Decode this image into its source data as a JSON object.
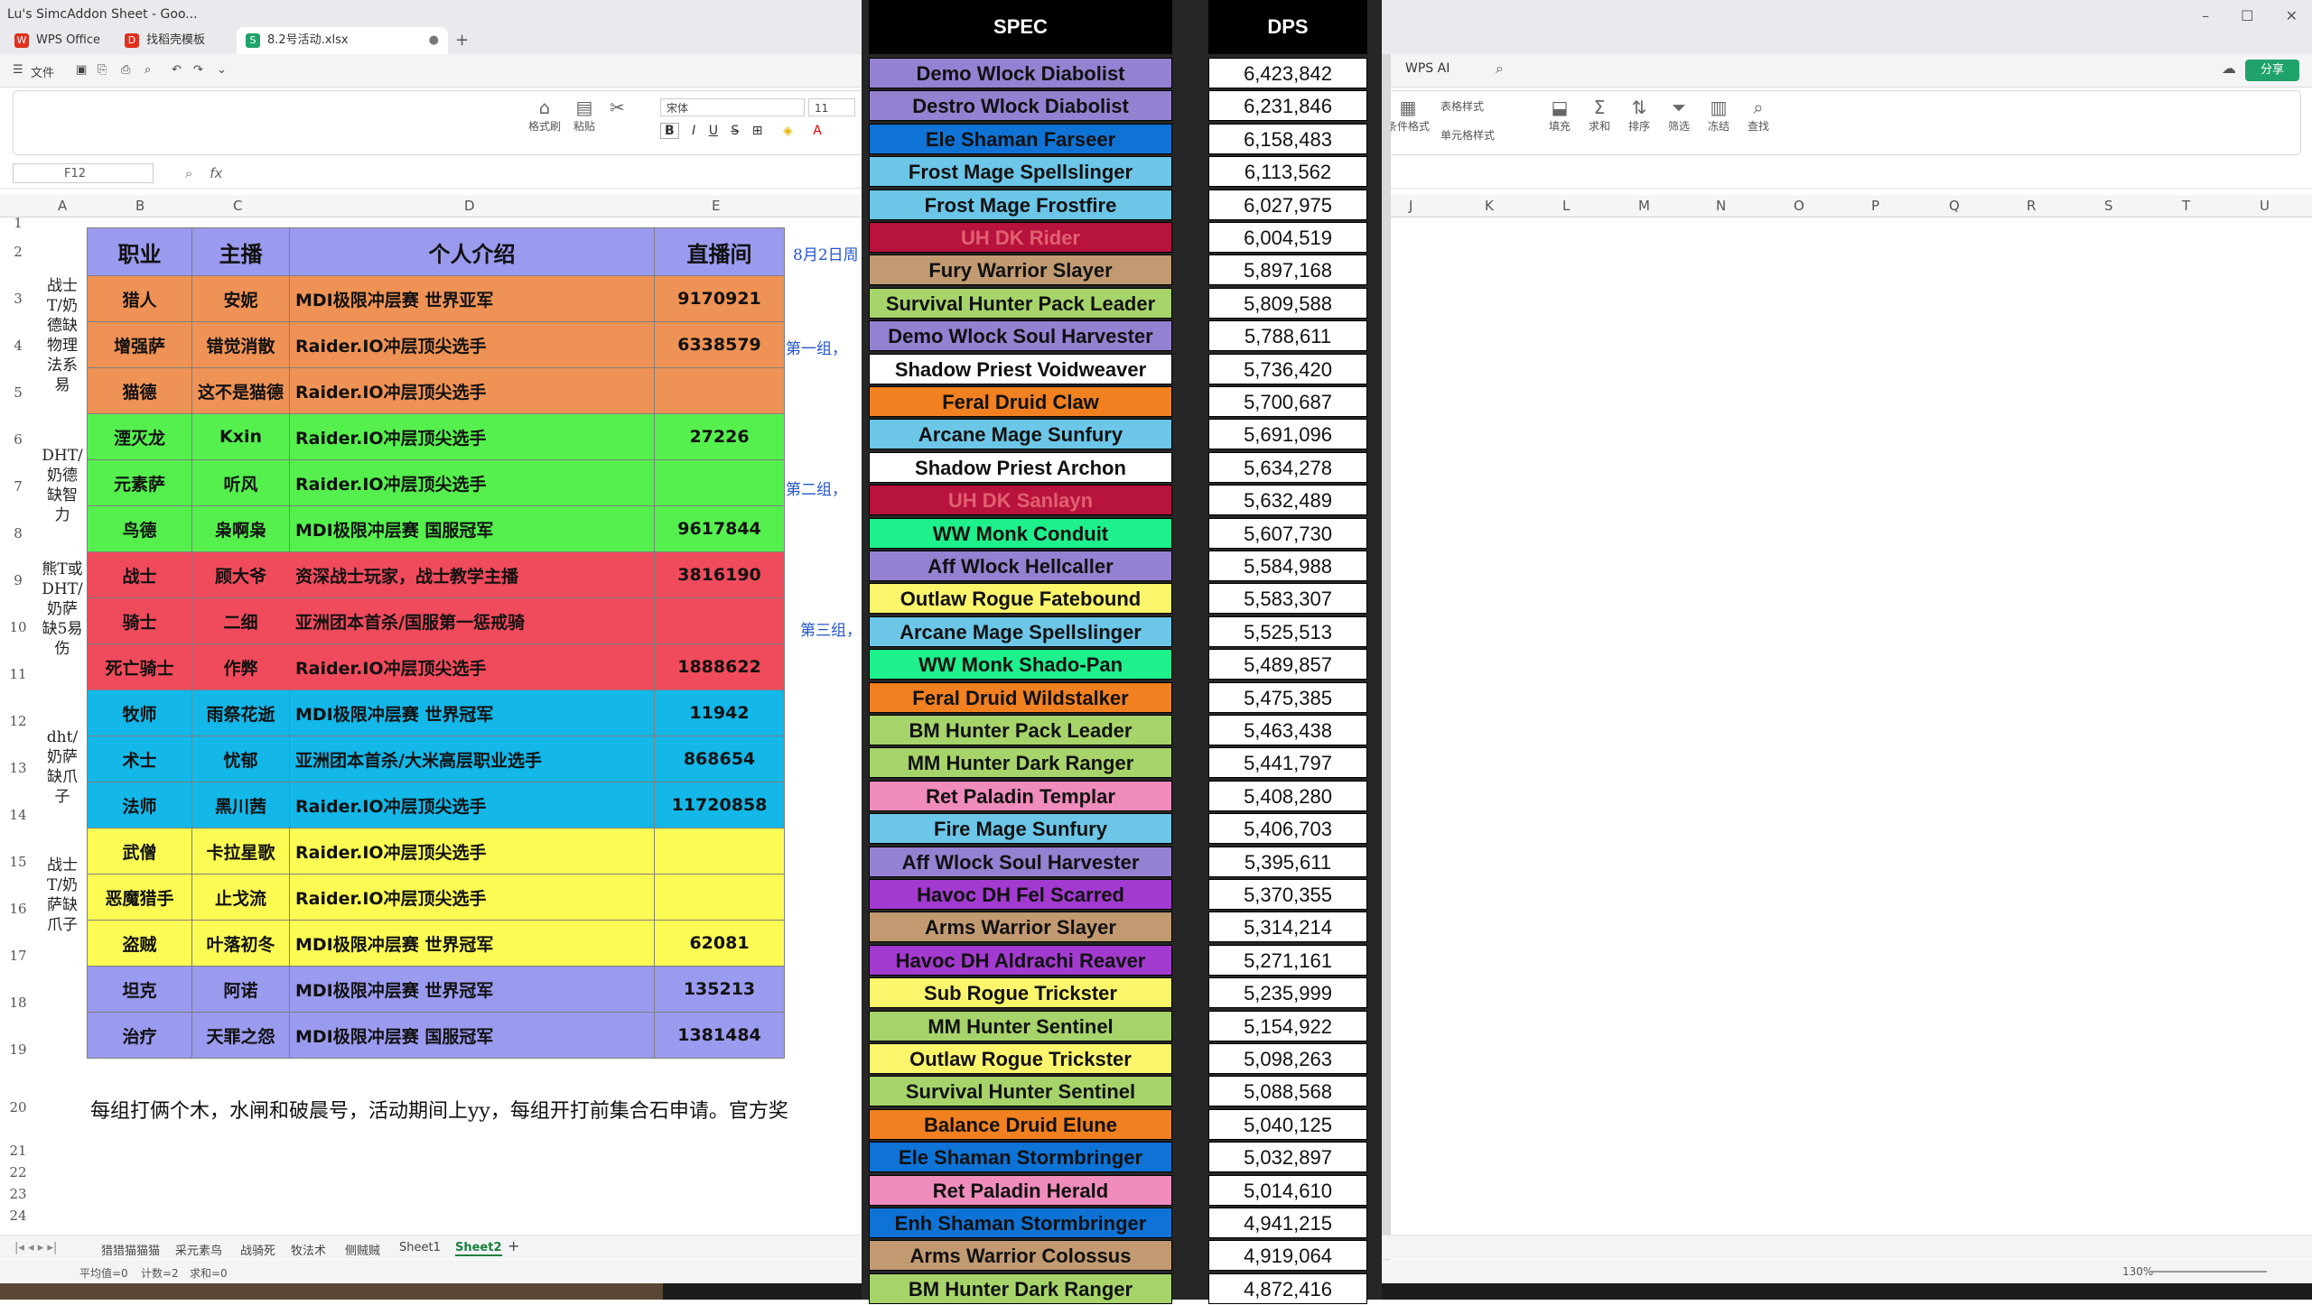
{
  "window": {
    "title": "Lu's SimcAddon Sheet - Goo...",
    "tabs": [
      {
        "label": "WPS Office",
        "icon": "wps-icon"
      },
      {
        "label": "找稻壳模板",
        "icon": "docer-icon"
      },
      {
        "label": "8.2号活动.xlsx",
        "icon": "sheet-icon"
      }
    ]
  },
  "menu": {
    "file_label": "文件"
  },
  "ribbon": {
    "format_painter": "格式刷",
    "paste": "粘贴",
    "font_name": "宋体",
    "font_size": "11",
    "table_style": "表格样式",
    "cond_format": "条件格式",
    "cell_style": "单元格样式",
    "fill": "填充",
    "sum": "求和",
    "sort": "排序",
    "filter": "筛选",
    "freeze": "冻结",
    "find": "查找",
    "wps_ai": "WPS AI",
    "share": "分享"
  },
  "formula_bar": {
    "cell_ref": "F12",
    "fx": "fx"
  },
  "columns": [
    "A",
    "B",
    "C",
    "D",
    "E",
    "J",
    "K",
    "L",
    "M",
    "N",
    "O",
    "P",
    "Q",
    "R",
    "S",
    "T",
    "U"
  ],
  "rows": [
    "1",
    "2",
    "3",
    "4",
    "5",
    "6",
    "7",
    "8",
    "9",
    "10",
    "11",
    "12",
    "13",
    "14",
    "15",
    "16",
    "17",
    "18",
    "19",
    "20",
    "21",
    "22",
    "23",
    "24"
  ],
  "sheet": {
    "headers": [
      "职业",
      "主播",
      "个人介绍",
      "直播间"
    ],
    "header_color": "#9a9aef",
    "rows": [
      {
        "cls": "猎人",
        "name": "安妮",
        "intro": "MDI极限冲层赛 世界亚军",
        "room": "9170921",
        "color": "#ef9255"
      },
      {
        "cls": "增强萨",
        "name": "错觉消散",
        "intro": "Raider.IO冲层顶尖选手",
        "room": "6338579",
        "color": "#ef9255"
      },
      {
        "cls": "猫德",
        "name": "这不是猫德",
        "intro": "Raider.IO冲层顶尖选手",
        "room": "",
        "color": "#ef9255"
      },
      {
        "cls": "湮灭龙",
        "name": "Kxin",
        "intro": "Raider.IO冲层顶尖选手",
        "room": "27226",
        "color": "#55f04e"
      },
      {
        "cls": "元素萨",
        "name": "听风",
        "intro": "Raider.IO冲层顶尖选手",
        "room": "",
        "color": "#55f04e"
      },
      {
        "cls": "鸟德",
        "name": "枭啊枭",
        "intro": "MDI极限冲层赛 国服冠军",
        "room": "9617844",
        "color": "#55f04e"
      },
      {
        "cls": "战士",
        "name": "顾大爷",
        "intro": "资深战士玩家，战士教学主播",
        "room": "3816190",
        "color": "#f04b5c"
      },
      {
        "cls": "骑士",
        "name": "二细",
        "intro": "亚洲团本首杀/国服第一惩戒骑",
        "room": "",
        "color": "#f04b5c"
      },
      {
        "cls": "死亡骑士",
        "name": "作弊",
        "intro": "Raider.IO冲层顶尖选手",
        "room": "1888622",
        "color": "#f04b5c"
      },
      {
        "cls": "牧师",
        "name": "雨祭花逝",
        "intro": "MDI极限冲层赛 世界冠军",
        "room": "11942",
        "color": "#13b7e8"
      },
      {
        "cls": "术士",
        "name": "忧郁",
        "intro": "亚洲团本首杀/大米高层职业选手",
        "room": "868654",
        "color": "#13b7e8"
      },
      {
        "cls": "法师",
        "name": "黑川茜",
        "intro": "Raider.IO冲层顶尖选手",
        "room": "11720858",
        "color": "#13b7e8"
      },
      {
        "cls": "武僧",
        "name": "卡拉星歌",
        "intro": "Raider.IO冲层顶尖选手",
        "room": "",
        "color": "#fbfb54"
      },
      {
        "cls": "恶魔猎手",
        "name": "止戈流",
        "intro": "Raider.IO冲层顶尖选手",
        "room": "",
        "color": "#fbfb54"
      },
      {
        "cls": "盗贼",
        "name": "叶落初冬",
        "intro": "MDI极限冲层赛 世界冠军",
        "room": "62081",
        "color": "#fbfb54"
      },
      {
        "cls": "坦克",
        "name": "阿诺",
        "intro": "MDI极限冲层赛 世界冠军",
        "room": "135213",
        "color": "#9a9aef"
      },
      {
        "cls": "治疗",
        "name": "天罪之怨",
        "intro": "MDI极限冲层赛 国服冠军",
        "room": "1381484",
        "color": "#9a9aef"
      }
    ],
    "groups": [
      "战士T/奶德缺物理法系易",
      "DHT/奶德缺智力",
      "熊T或DHT/奶萨缺5易伤",
      "dht/奶萨缺爪子",
      "战士T/奶萨缺爪子"
    ],
    "side_notes": [
      "8月2日周",
      "第一组，",
      "第二组，",
      "第三组，"
    ],
    "footnote": "每组打俩个木，水闸和破晨号，活动期间上yy，每组开打前集合石申请。官方奖"
  },
  "sheet_tabs": [
    "猎猎猫猫猫",
    "采元素鸟",
    "战骑死",
    "牧法术",
    "侧贼贼",
    "Sheet1",
    "Sheet2"
  ],
  "status": {
    "avg": "平均值=0",
    "count": "计数=2",
    "sum": "求和=0",
    "zoom": "130%"
  },
  "dps_table": {
    "headers": {
      "spec": "SPEC",
      "dps": "DPS"
    },
    "rows": [
      {
        "spec": "Demo Wlock Diabolist",
        "dps": "6,423,842",
        "bg": "#9481d1",
        "fg": "#111111"
      },
      {
        "spec": "Destro Wlock Diabolist",
        "dps": "6,231,846",
        "bg": "#9481d1",
        "fg": "#111111"
      },
      {
        "spec": "Ele Shaman Farseer",
        "dps": "6,158,483",
        "bg": "#0f73d6",
        "fg": "#111111"
      },
      {
        "spec": "Frost Mage Spellslinger",
        "dps": "6,113,562",
        "bg": "#6cc6e8",
        "fg": "#111111"
      },
      {
        "spec": "Frost Mage Frostfire",
        "dps": "6,027,975",
        "bg": "#6cc6e8",
        "fg": "#111111"
      },
      {
        "spec": "UH DK Rider",
        "dps": "6,004,519",
        "bg": "#b8133c",
        "fg": "#e06070"
      },
      {
        "spec": "Fury Warrior Slayer",
        "dps": "5,897,168",
        "bg": "#c29a72",
        "fg": "#111111"
      },
      {
        "spec": "Survival Hunter Pack Leader",
        "dps": "5,809,588",
        "bg": "#a6d46a",
        "fg": "#111111"
      },
      {
        "spec": "Demo Wlock Soul Harvester",
        "dps": "5,788,611",
        "bg": "#9481d1",
        "fg": "#111111"
      },
      {
        "spec": "Shadow Priest Voidweaver",
        "dps": "5,736,420",
        "bg": "#ffffff",
        "fg": "#111111"
      },
      {
        "spec": "Feral Druid Claw",
        "dps": "5,700,687",
        "bg": "#f08020",
        "fg": "#111111"
      },
      {
        "spec": "Arcane Mage Sunfury",
        "dps": "5,691,096",
        "bg": "#6cc6e8",
        "fg": "#111111"
      },
      {
        "spec": "Shadow Priest Archon",
        "dps": "5,634,278",
        "bg": "#ffffff",
        "fg": "#111111"
      },
      {
        "spec": "UH DK Sanlayn",
        "dps": "5,632,489",
        "bg": "#b8133c",
        "fg": "#e06070"
      },
      {
        "spec": "WW Monk Conduit",
        "dps": "5,607,730",
        "bg": "#1ef08c",
        "fg": "#111111"
      },
      {
        "spec": "Aff Wlock Hellcaller",
        "dps": "5,584,988",
        "bg": "#9481d1",
        "fg": "#111111"
      },
      {
        "spec": "Outlaw Rogue Fatebound",
        "dps": "5,583,307",
        "bg": "#fbf56b",
        "fg": "#111111"
      },
      {
        "spec": "Arcane Mage Spellslinger",
        "dps": "5,525,513",
        "bg": "#6cc6e8",
        "fg": "#111111"
      },
      {
        "spec": "WW Monk Shado-Pan",
        "dps": "5,489,857",
        "bg": "#1ef08c",
        "fg": "#111111"
      },
      {
        "spec": "Feral Druid Wildstalker",
        "dps": "5,475,385",
        "bg": "#f08020",
        "fg": "#111111"
      },
      {
        "spec": "BM Hunter Pack Leader",
        "dps": "5,463,438",
        "bg": "#a6d46a",
        "fg": "#111111"
      },
      {
        "spec": "MM Hunter Dark Ranger",
        "dps": "5,441,797",
        "bg": "#a6d46a",
        "fg": "#111111"
      },
      {
        "spec": "Ret Paladin Templar",
        "dps": "5,408,280",
        "bg": "#f08cbc",
        "fg": "#111111"
      },
      {
        "spec": "Fire Mage Sunfury",
        "dps": "5,406,703",
        "bg": "#6cc6e8",
        "fg": "#111111"
      },
      {
        "spec": "Aff Wlock Soul Harvester",
        "dps": "5,395,611",
        "bg": "#9481d1",
        "fg": "#111111"
      },
      {
        "spec": "Havoc DH Fel Scarred",
        "dps": "5,370,355",
        "bg": "#a33ad0",
        "fg": "#111111"
      },
      {
        "spec": "Arms Warrior Slayer",
        "dps": "5,314,214",
        "bg": "#c29a72",
        "fg": "#111111"
      },
      {
        "spec": "Havoc DH Aldrachi Reaver",
        "dps": "5,271,161",
        "bg": "#a33ad0",
        "fg": "#111111"
      },
      {
        "spec": "Sub Rogue Trickster",
        "dps": "5,235,999",
        "bg": "#fbf56b",
        "fg": "#111111"
      },
      {
        "spec": "MM Hunter Sentinel",
        "dps": "5,154,922",
        "bg": "#a6d46a",
        "fg": "#111111"
      },
      {
        "spec": "Outlaw Rogue Trickster",
        "dps": "5,098,263",
        "bg": "#fbf56b",
        "fg": "#111111"
      },
      {
        "spec": "Survival Hunter Sentinel",
        "dps": "5,088,568",
        "bg": "#a6d46a",
        "fg": "#111111"
      },
      {
        "spec": "Balance Druid Elune",
        "dps": "5,040,125",
        "bg": "#f08020",
        "fg": "#111111"
      },
      {
        "spec": "Ele Shaman Stormbringer",
        "dps": "5,032,897",
        "bg": "#0f73d6",
        "fg": "#111111"
      },
      {
        "spec": "Ret Paladin Herald",
        "dps": "5,014,610",
        "bg": "#f08cbc",
        "fg": "#111111"
      },
      {
        "spec": "Enh Shaman Stormbringer",
        "dps": "4,941,215",
        "bg": "#0f73d6",
        "fg": "#111111"
      },
      {
        "spec": "Arms Warrior Colossus",
        "dps": "4,919,064",
        "bg": "#c29a72",
        "fg": "#111111"
      },
      {
        "spec": "BM Hunter Dark Ranger",
        "dps": "4,872,416",
        "bg": "#a6d46a",
        "fg": "#111111"
      }
    ]
  }
}
